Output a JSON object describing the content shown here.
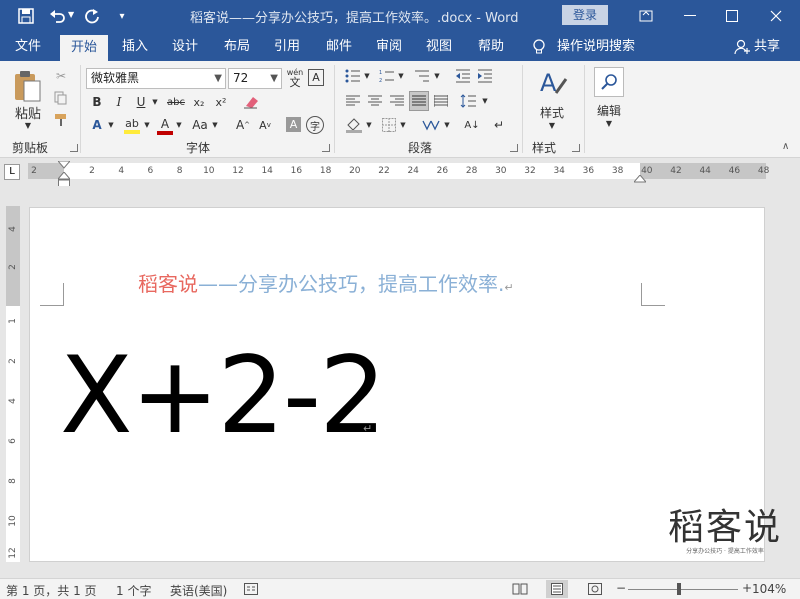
{
  "titlebar": {
    "title": "稻客说——分享办公技巧，提高工作效率。.docx  -  Word",
    "signin": "登录",
    "colors": {
      "bg": "#2b579a"
    }
  },
  "tabs": {
    "file": "文件",
    "home": "开始",
    "insert": "插入",
    "design": "设计",
    "layout": "布局",
    "references": "引用",
    "mailings": "邮件",
    "review": "审阅",
    "view": "视图",
    "help": "帮助",
    "tellme": "操作说明搜索",
    "share": "共享"
  },
  "ribbon": {
    "clipboard": {
      "paste": "粘贴",
      "label": "剪贴板"
    },
    "font": {
      "name": "微软雅黑",
      "size": "72",
      "label": "字体",
      "phonetic": "wén"
    },
    "paragraph": {
      "label": "段落"
    },
    "styles": {
      "button": "样式",
      "label": "样式"
    },
    "editing": {
      "button": "编辑"
    }
  },
  "ruler": {
    "ticks": [
      "2",
      "2",
      "4",
      "6",
      "8",
      "10",
      "12",
      "14",
      "16",
      "18",
      "20",
      "22",
      "24",
      "26",
      "28",
      "30",
      "32",
      "34",
      "36",
      "38",
      "40",
      "42",
      "44",
      "46",
      "48"
    ],
    "vticks": [
      "4",
      "2",
      "1",
      "2",
      "4",
      "6",
      "8",
      "10",
      "12"
    ]
  },
  "document": {
    "header_red": "稻客说",
    "header_rest": "——分享办公技巧，提高工作效率.",
    "formula": "X+2-2",
    "colors": {
      "red": "#e8685f",
      "blue": "#8ab0d6"
    }
  },
  "watermark": {
    "title": "稻客说",
    "subtitle": "分享办公技巧 · 提高工作效率"
  },
  "statusbar": {
    "page": "第 1 页，共 1 页",
    "words": "1 个字",
    "language": "英语(美国)",
    "zoom": "104%"
  }
}
